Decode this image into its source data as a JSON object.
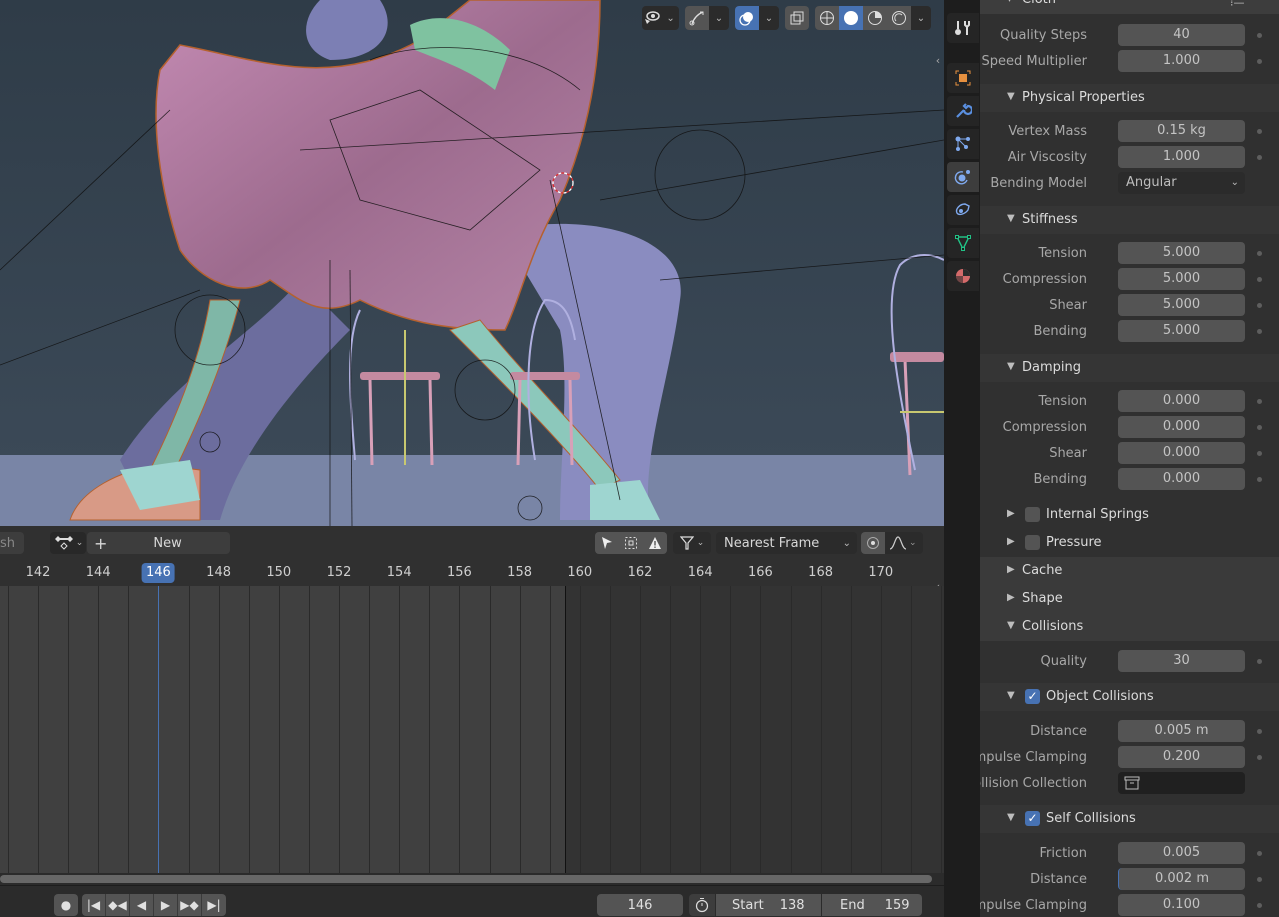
{
  "viewport": {
    "toolbar": {
      "visibility_icon": "eye-pointer-icon",
      "gizmo_icon": "gizmo-icon",
      "overlay_icon": "overlay-icon",
      "xray_icon": "xray-icon",
      "shading_modes": [
        "wireframe",
        "solid",
        "material-preview",
        "rendered"
      ],
      "active_shading": "solid"
    }
  },
  "timeline": {
    "header": {
      "left_clip_text": "sh",
      "new_action_label": "New",
      "snap_mode": "Nearest Frame"
    },
    "ruler": {
      "ticks": [
        "142",
        "144",
        "146",
        "148",
        "150",
        "152",
        "154",
        "156",
        "158",
        "160",
        "162",
        "164",
        "166",
        "168",
        "170"
      ],
      "current_frame": "146"
    },
    "playback": {
      "current_frame": "146",
      "start_label": "Start",
      "start_value": "138",
      "end_label": "End",
      "end_value": "159"
    }
  },
  "properties": {
    "tabs": [
      "tool",
      "object",
      "modifiers",
      "particles",
      "physics",
      "constraints",
      "data",
      "material"
    ],
    "active_tab": "physics",
    "cloth_title": "Cloth",
    "quality_steps": {
      "label": "Quality Steps",
      "value": "40"
    },
    "speed_multiplier": {
      "label": "Speed Multiplier",
      "value": "1.000"
    },
    "physical": {
      "title": "Physical Properties",
      "vertex_mass": {
        "label": "Vertex Mass",
        "value": "0.15 kg"
      },
      "air_viscosity": {
        "label": "Air Viscosity",
        "value": "1.000"
      },
      "bending_model": {
        "label": "Bending Model",
        "value": "Angular"
      }
    },
    "stiffness": {
      "title": "Stiffness",
      "rows": [
        {
          "label": "Tension",
          "value": "5.000"
        },
        {
          "label": "Compression",
          "value": "5.000"
        },
        {
          "label": "Shear",
          "value": "5.000"
        },
        {
          "label": "Bending",
          "value": "5.000"
        }
      ]
    },
    "damping": {
      "title": "Damping",
      "rows": [
        {
          "label": "Tension",
          "value": "0.000"
        },
        {
          "label": "Compression",
          "value": "0.000"
        },
        {
          "label": "Shear",
          "value": "0.000"
        },
        {
          "label": "Bending",
          "value": "0.000"
        }
      ]
    },
    "internal_springs": {
      "title": "Internal Springs",
      "enabled": false
    },
    "pressure": {
      "title": "Pressure",
      "enabled": false
    },
    "cache": {
      "title": "Cache"
    },
    "shape": {
      "title": "Shape"
    },
    "collisions": {
      "title": "Collisions",
      "quality": {
        "label": "Quality",
        "value": "30"
      },
      "object": {
        "title": "Object Collisions",
        "enabled": true,
        "distance": {
          "label": "Distance",
          "value": "0.005 m"
        },
        "impulse": {
          "label": "Impulse Clamping",
          "value": "0.200"
        },
        "collection": {
          "label": "Collision Collection",
          "value": ""
        }
      },
      "self": {
        "title": "Self Collisions",
        "enabled": true,
        "friction": {
          "label": "Friction",
          "value": "0.005"
        },
        "distance": {
          "label": "Distance",
          "value": "0.002 m"
        },
        "impulse": {
          "label": "Impulse Clamping",
          "value": "0.100"
        }
      }
    }
  }
}
